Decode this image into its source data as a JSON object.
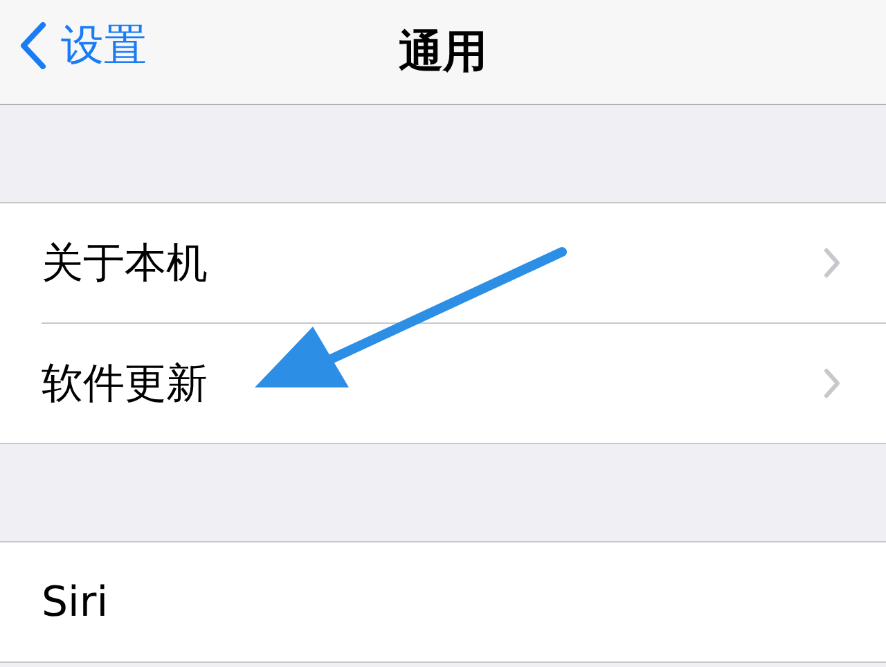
{
  "nav_bar": {
    "back_label": "设置",
    "title": "通用"
  },
  "groups": [
    {
      "items": [
        {
          "label": "关于本机",
          "chevron": true
        },
        {
          "label": "软件更新",
          "chevron": true
        }
      ]
    },
    {
      "items": [
        {
          "label": "Siri",
          "chevron": false
        }
      ]
    }
  ]
}
